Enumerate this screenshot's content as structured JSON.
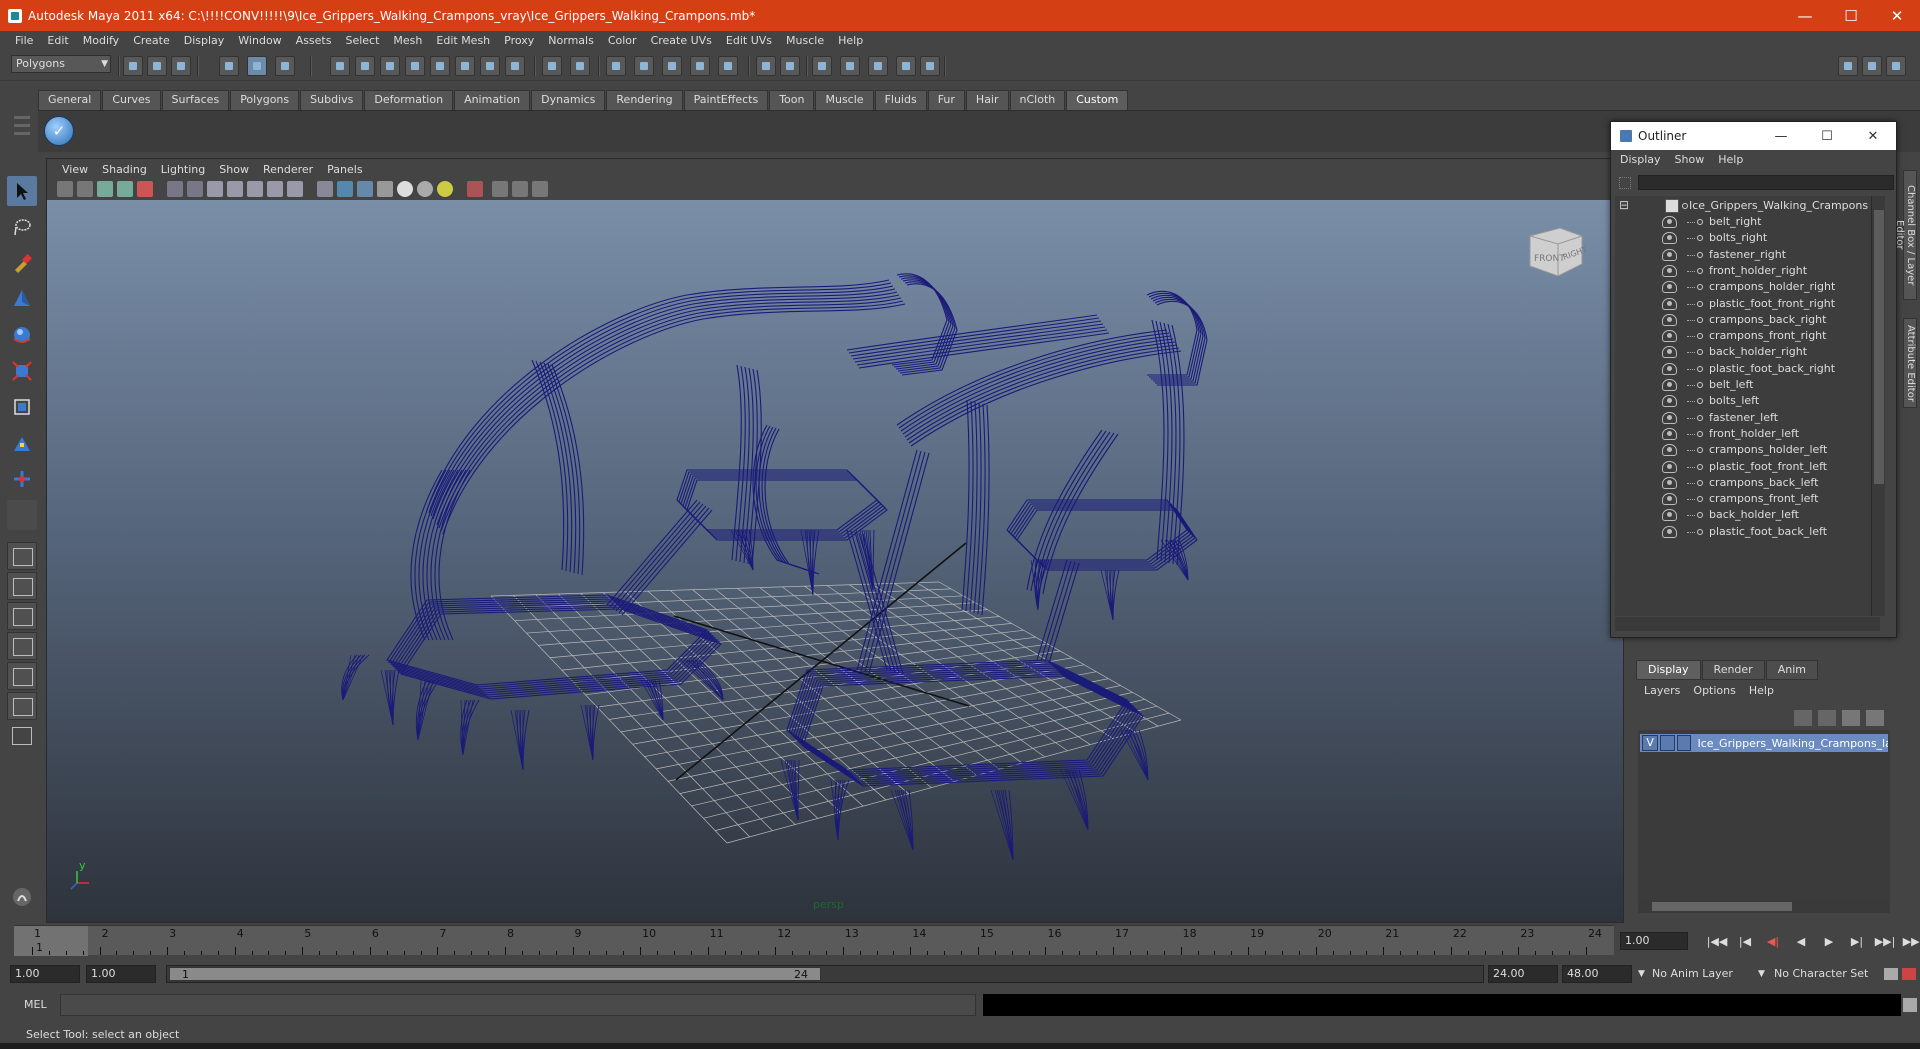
{
  "window": {
    "title": "Autodesk Maya 2011 x64: C:\\!!!!CONV!!!!!\\9\\Ice_Grippers_Walking_Crampons_vray\\Ice_Grippers_Walking_Crampons.mb*",
    "minimize": "—",
    "maximize": "☐",
    "close": "✕"
  },
  "menubar": [
    "File",
    "Edit",
    "Modify",
    "Create",
    "Display",
    "Window",
    "Assets",
    "Select",
    "Mesh",
    "Edit Mesh",
    "Proxy",
    "Normals",
    "Color",
    "Create UVs",
    "Edit UVs",
    "Muscle",
    "Help"
  ],
  "statusline": {
    "mode": "Polygons"
  },
  "shelf": {
    "tabs": [
      "General",
      "Curves",
      "Surfaces",
      "Polygons",
      "Subdivs",
      "Deformation",
      "Animation",
      "Dynamics",
      "Rendering",
      "PaintEffects",
      "Toon",
      "Muscle",
      "Fluids",
      "Fur",
      "Hair",
      "nCloth",
      "Custom"
    ],
    "active_tab": "Custom",
    "check_glyph": "✓"
  },
  "viewport": {
    "menus": [
      "View",
      "Shading",
      "Lighting",
      "Show",
      "Renderer",
      "Panels"
    ],
    "camera_label": "persp",
    "axis_y": "y",
    "axis_x": "x",
    "viewcube_front": "FRONT",
    "viewcube_right": "RIGHT",
    "wire_color": "#1a1a7a"
  },
  "outliner": {
    "title": "Outliner",
    "menus": [
      "Display",
      "Show",
      "Help"
    ],
    "root": "Ice_Grippers_Walking_Crampons",
    "root_toggle": "⊟",
    "items": [
      "belt_right",
      "bolts_right",
      "fastener_right",
      "front_holder_right",
      "crampons_holder_right",
      "plastic_foot_front_right",
      "crampons_back_right",
      "crampons_front_right",
      "back_holder_right",
      "plastic_foot_back_right",
      "belt_left",
      "bolts_left",
      "fastener_left",
      "front_holder_left",
      "crampons_holder_left",
      "plastic_foot_front_left",
      "crampons_back_left",
      "crampons_front_left",
      "back_holder_left",
      "plastic_foot_back_left"
    ],
    "minimize": "—",
    "maximize": "☐",
    "close": "✕"
  },
  "sidetabs": {
    "channel_box": "Channel Box / Layer Editor",
    "attribute_editor": "Attribute Editor"
  },
  "layer_editor": {
    "tabs": [
      "Display",
      "Render",
      "Anim"
    ],
    "active_tab": "Display",
    "menus": [
      "Layers",
      "Options",
      "Help"
    ],
    "layer_visible": "V",
    "layer_name": "Ice_Grippers_Walking_Crampons_layer"
  },
  "timeslider": {
    "ticks": [
      1,
      2,
      3,
      4,
      5,
      6,
      7,
      8,
      9,
      10,
      11,
      12,
      13,
      14,
      15,
      16,
      17,
      18,
      19,
      20,
      21,
      22,
      23,
      24
    ],
    "current_frame": "1",
    "current_time": "1.00",
    "buttons": [
      "|◀◀",
      "|◀",
      "◀|",
      "◀",
      "▶",
      "▶|",
      "▶▶|",
      "▶▶|"
    ]
  },
  "rangeslider": {
    "start_time": "1.00",
    "playback_start": "1.00",
    "range_start": "1",
    "range_end": "24",
    "playback_end": "24.00",
    "end_time": "48.00",
    "anim_layer": "No Anim Layer",
    "character_set": "No Character Set"
  },
  "cmdline": {
    "label": "MEL"
  },
  "helpline": {
    "text": "Select Tool: select an object"
  }
}
